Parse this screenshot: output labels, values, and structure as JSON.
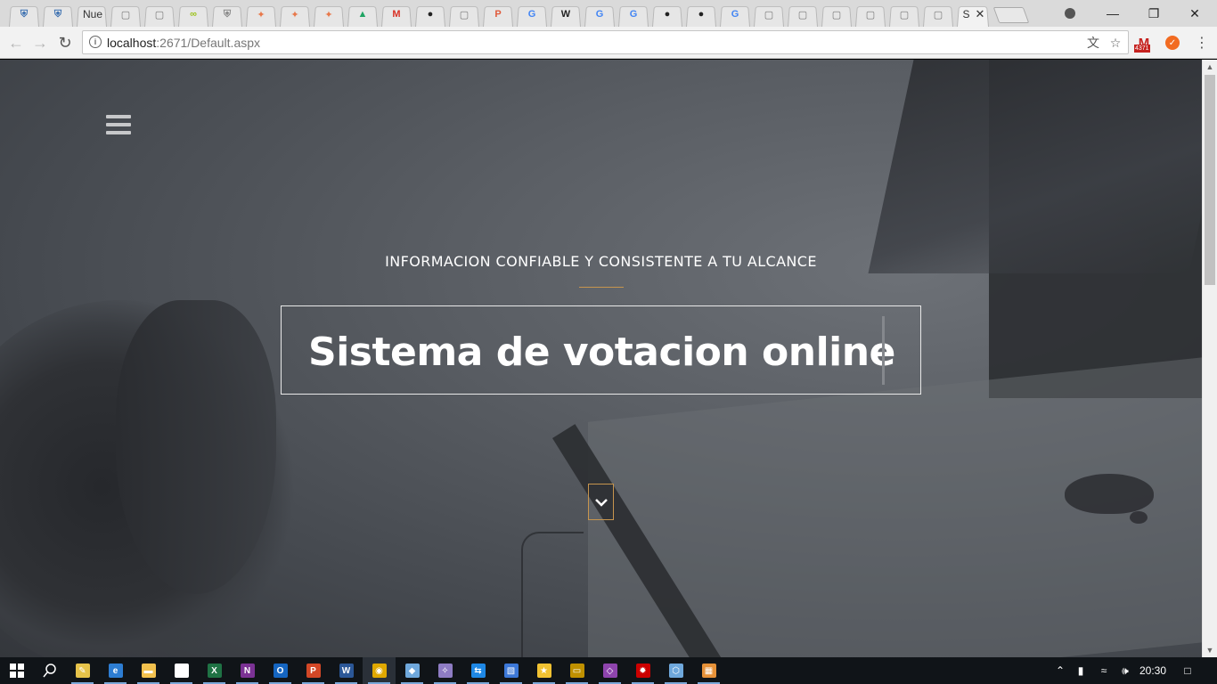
{
  "browser": {
    "tabs": [
      {
        "icon": "shield-icon",
        "glyph": "⛨",
        "color": "#3a6fb0",
        "label": ""
      },
      {
        "icon": "shield-icon",
        "glyph": "⛨",
        "color": "#3a6fb0",
        "label": ""
      },
      {
        "icon": "",
        "glyph": "",
        "color": "#333333",
        "label": "Nue"
      },
      {
        "icon": "page-icon",
        "glyph": "▢",
        "color": "#777777",
        "label": ""
      },
      {
        "icon": "page-icon",
        "glyph": "▢",
        "color": "#777777",
        "label": ""
      },
      {
        "icon": "link-icon",
        "glyph": "∞",
        "color": "#9bc21a",
        "label": ""
      },
      {
        "icon": "shield-icon",
        "glyph": "⛨",
        "color": "#888888",
        "label": ""
      },
      {
        "icon": "fish-icon",
        "glyph": "✦",
        "color": "#e8784a",
        "label": ""
      },
      {
        "icon": "fish-icon",
        "glyph": "✦",
        "color": "#e8784a",
        "label": ""
      },
      {
        "icon": "fish-icon",
        "glyph": "✦",
        "color": "#e8784a",
        "label": ""
      },
      {
        "icon": "drive-icon",
        "glyph": "▲",
        "color": "#1fa463",
        "label": ""
      },
      {
        "icon": "gmail-icon",
        "glyph": "M",
        "color": "#d93025",
        "label": ""
      },
      {
        "icon": "github-icon",
        "glyph": "●",
        "color": "#222222",
        "label": ""
      },
      {
        "icon": "page-icon",
        "glyph": "▢",
        "color": "#777777",
        "label": ""
      },
      {
        "icon": "pdf-icon",
        "glyph": "P",
        "color": "#e05b3c",
        "label": ""
      },
      {
        "icon": "google-icon",
        "glyph": "G",
        "color": "#4285f4",
        "label": ""
      },
      {
        "icon": "wikipedia-icon",
        "glyph": "W",
        "color": "#222222",
        "label": ""
      },
      {
        "icon": "google-icon",
        "glyph": "G",
        "color": "#4285f4",
        "label": ""
      },
      {
        "icon": "google-icon",
        "glyph": "G",
        "color": "#4285f4",
        "label": ""
      },
      {
        "icon": "github-icon",
        "glyph": "●",
        "color": "#222222",
        "label": ""
      },
      {
        "icon": "github-icon",
        "glyph": "●",
        "color": "#222222",
        "label": ""
      },
      {
        "icon": "google-icon",
        "glyph": "G",
        "color": "#4285f4",
        "label": ""
      },
      {
        "icon": "page-icon",
        "glyph": "▢",
        "color": "#777777",
        "label": ""
      },
      {
        "icon": "page-icon",
        "glyph": "▢",
        "color": "#777777",
        "label": ""
      },
      {
        "icon": "page-icon",
        "glyph": "▢",
        "color": "#777777",
        "label": ""
      },
      {
        "icon": "page-icon",
        "glyph": "▢",
        "color": "#777777",
        "label": ""
      },
      {
        "icon": "page-icon",
        "glyph": "▢",
        "color": "#777777",
        "label": ""
      },
      {
        "icon": "page-icon",
        "glyph": "▢",
        "color": "#777777",
        "label": ""
      }
    ],
    "active_tab": {
      "label": "S",
      "close": "✕"
    },
    "window_controls": {
      "minimize": "—",
      "restore": "❐",
      "close": "✕"
    },
    "url_host": "localhost",
    "url_path": ":2671/Default.aspx",
    "gmail_badge": "4371"
  },
  "page": {
    "tagline": "INFORMACION CONFIABLE Y CONSISTENTE A TU ALCANCE",
    "headline": "Sistema de votacion online",
    "accent_color": "#c7954e"
  },
  "taskbar": {
    "apps": [
      {
        "icon": "file-explorer-tool-icon",
        "glyph": "✎",
        "color": "#e6c34a"
      },
      {
        "icon": "edge-icon",
        "glyph": "e",
        "color": "#2d7dd2"
      },
      {
        "icon": "folder-icon",
        "glyph": "▬",
        "color": "#f2c14e"
      },
      {
        "icon": "store-icon",
        "glyph": "▣",
        "color": "#ffffff"
      },
      {
        "icon": "excel-icon",
        "glyph": "X",
        "color": "#1f7244"
      },
      {
        "icon": "onenote-icon",
        "glyph": "N",
        "color": "#7b3294"
      },
      {
        "icon": "outlook-icon",
        "glyph": "O",
        "color": "#1565c0"
      },
      {
        "icon": "powerpoint-icon",
        "glyph": "P",
        "color": "#d24726"
      },
      {
        "icon": "word-icon",
        "glyph": "W",
        "color": "#2b5797"
      },
      {
        "icon": "chrome-icon",
        "glyph": "◉",
        "color": "#e0a800"
      },
      {
        "icon": "cube-icon",
        "glyph": "◆",
        "color": "#6fa8dc"
      },
      {
        "icon": "dolphin-icon",
        "glyph": "✧",
        "color": "#8e7cc3"
      },
      {
        "icon": "teamviewer-icon",
        "glyph": "⇆",
        "color": "#1e88e5"
      },
      {
        "icon": "network-icon",
        "glyph": "▧",
        "color": "#3c78d8"
      },
      {
        "icon": "star-icon",
        "glyph": "★",
        "color": "#f1c232"
      },
      {
        "icon": "monitor-icon",
        "glyph": "▭",
        "color": "#bf9000"
      },
      {
        "icon": "visual-studio-icon",
        "glyph": "◇",
        "color": "#8e44ad"
      },
      {
        "icon": "settings-app-icon",
        "glyph": "✹",
        "color": "#cc0000"
      },
      {
        "icon": "virtualbox-icon",
        "glyph": "⬡",
        "color": "#6fa8dc"
      },
      {
        "icon": "tiles-icon",
        "glyph": "▦",
        "color": "#e69138"
      }
    ],
    "clock": "20:30"
  }
}
